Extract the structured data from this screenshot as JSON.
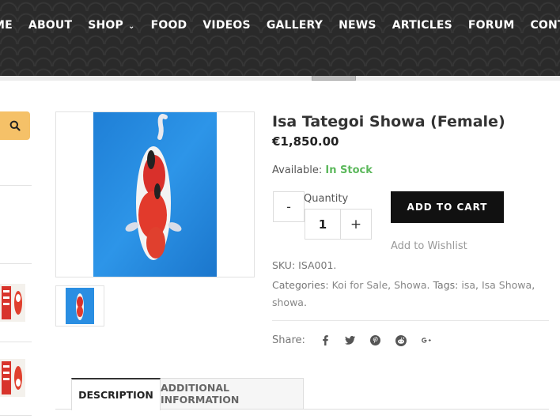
{
  "nav": {
    "items": [
      {
        "label": "ME"
      },
      {
        "label": "ABOUT"
      },
      {
        "label": "SHOP",
        "dropdown_glyph": "⌄"
      },
      {
        "label": "FOOD"
      },
      {
        "label": "VIDEOS"
      },
      {
        "label": "GALLERY"
      },
      {
        "label": "NEWS"
      },
      {
        "label": "ARTICLES"
      },
      {
        "label": "FORUM"
      },
      {
        "label": "CONTACT"
      }
    ]
  },
  "product": {
    "title": "Isa Tategoi Showa (Female)",
    "price": "€1,850.00",
    "availability_label": "Available:",
    "availability_status": "In Stock",
    "quantity_label": "Quantity",
    "quantity_value": "1",
    "minus_label": "-",
    "plus_label": "+",
    "add_to_cart_label": "ADD TO CART",
    "wishlist_label": "Add to Wishlist",
    "sku_label": "SKU:",
    "sku_value": "ISA001.",
    "categories_label": "Categories:",
    "categories": [
      "Koi for Sale",
      "Showa"
    ],
    "tags_label": "Tags:",
    "tags": [
      "isa",
      "Isa Showa",
      "showa"
    ],
    "share_label": "Share:"
  },
  "share_icons": [
    "facebook-icon",
    "twitter-icon",
    "pinterest-icon",
    "reddit-icon",
    "google-plus-icon"
  ],
  "tabs": [
    {
      "label": "DESCRIPTION",
      "active": true
    },
    {
      "label": "ADDITIONAL INFORMATION",
      "active": false
    }
  ],
  "colors": {
    "accent": "#f5c168",
    "in_stock": "#5cb85c",
    "button": "#111111"
  }
}
